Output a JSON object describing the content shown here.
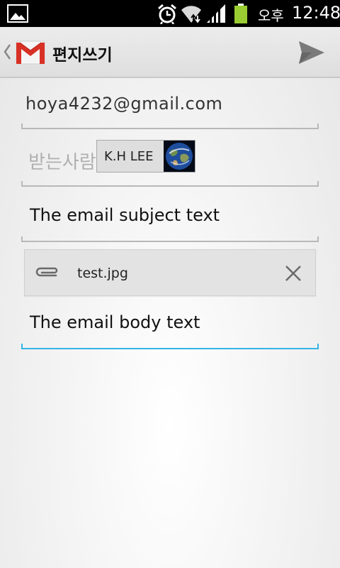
{
  "status_bar": {
    "ampm": "오후",
    "time": "12:48",
    "battery_color": "#9acd32",
    "icons": [
      "gallery-icon",
      "alarm-icon",
      "wifi-icon",
      "signal-icon",
      "battery-icon"
    ]
  },
  "action_bar": {
    "title": "편지쓰기",
    "logo": "gmail-icon",
    "send_icon": "send-icon"
  },
  "compose": {
    "from": "hoya4232@gmail.com",
    "to_label": "받는사람",
    "recipient_chip": "K.H LEE",
    "subject": "The email subject text",
    "attachment_name": "test.jpg",
    "body": "The email body text"
  },
  "colors": {
    "focus_underline": "#33b5e5",
    "gmail_red": "#d93025"
  }
}
